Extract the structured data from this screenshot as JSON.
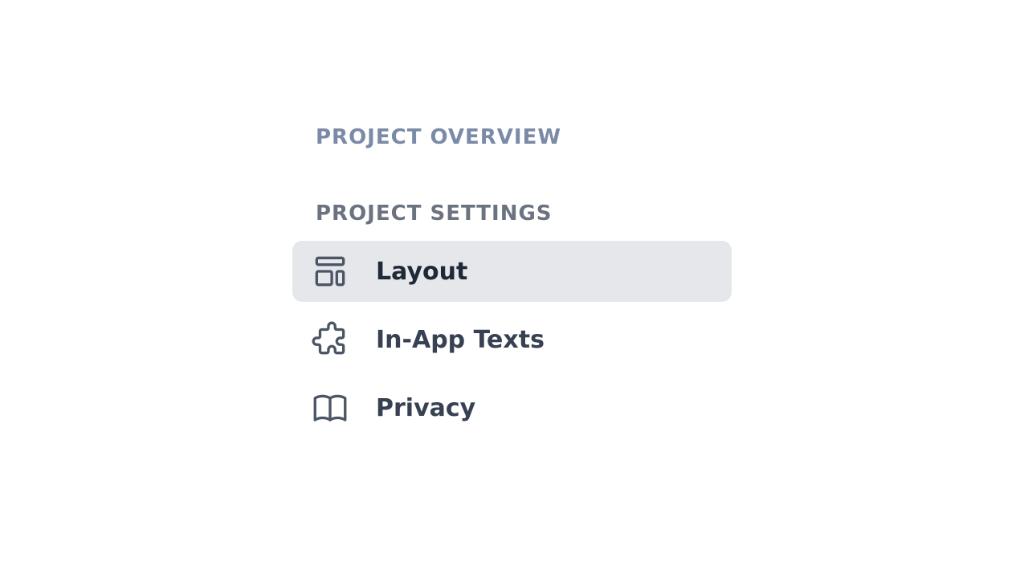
{
  "nav": {
    "overview_link": "PROJECT OVERVIEW",
    "settings_heading": "PROJECT SETTINGS",
    "items": [
      {
        "label": "Layout",
        "icon": "template-icon",
        "active": true
      },
      {
        "label": "In-App Texts",
        "icon": "puzzle-icon",
        "active": false
      },
      {
        "label": "Privacy",
        "icon": "book-open-icon",
        "active": false
      }
    ]
  },
  "colors": {
    "overview_text": "#7b8aa6",
    "heading_text": "#6b7280",
    "active_bg": "#e5e7eb",
    "icon_stroke": "#4b5563"
  }
}
